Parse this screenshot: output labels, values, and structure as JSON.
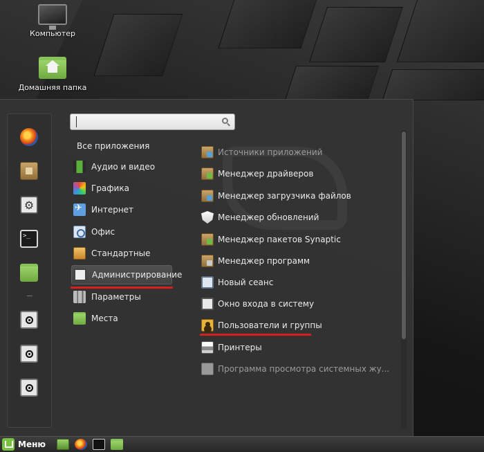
{
  "desktop": {
    "icons": [
      {
        "label": "Компьютер",
        "icon": "computer-icon"
      },
      {
        "label": "Домашняя папка",
        "icon": "home-folder-icon"
      }
    ]
  },
  "menu": {
    "favorites": [
      {
        "icon": "firefox-icon"
      },
      {
        "icon": "package-manager-icon"
      },
      {
        "icon": "system-settings-icon"
      },
      {
        "icon": "terminal-icon"
      },
      {
        "icon": "folder-icon"
      },
      {
        "icon": "lock-screen-icon"
      },
      {
        "icon": "logout-icon"
      },
      {
        "icon": "shutdown-icon"
      }
    ],
    "search": {
      "value": "",
      "placeholder": ""
    },
    "all_apps_label": "Все приложения",
    "categories": [
      {
        "label": "Аудио и видео",
        "icon": "audio-video-icon"
      },
      {
        "label": "Графика",
        "icon": "graphics-icon"
      },
      {
        "label": "Интернет",
        "icon": "internet-icon"
      },
      {
        "label": "Офис",
        "icon": "office-icon"
      },
      {
        "label": "Стандартные",
        "icon": "accessories-icon"
      },
      {
        "label": "Администрирование",
        "icon": "administration-icon",
        "active": true
      },
      {
        "label": "Параметры",
        "icon": "preferences-icon"
      },
      {
        "label": "Места",
        "icon": "places-icon"
      }
    ],
    "apps": [
      {
        "label": "Источники приложений",
        "icon": "software-sources-icon"
      },
      {
        "label": "Менеджер драйверов",
        "icon": "driver-manager-icon"
      },
      {
        "label": "Менеджер загрузчика файлов",
        "icon": "upload-manager-icon"
      },
      {
        "label": "Менеджер обновлений",
        "icon": "update-manager-icon"
      },
      {
        "label": "Менеджер пакетов Synaptic",
        "icon": "synaptic-icon"
      },
      {
        "label": "Менеджер программ",
        "icon": "software-manager-icon"
      },
      {
        "label": "Новый сеанс",
        "icon": "new-session-icon"
      },
      {
        "label": "Окно входа в систему",
        "icon": "login-window-icon"
      },
      {
        "label": "Пользователи и группы",
        "icon": "users-groups-icon"
      },
      {
        "label": "Принтеры",
        "icon": "printers-icon"
      },
      {
        "label": "Программа просмотра системных жу...",
        "icon": "system-log-icon"
      }
    ]
  },
  "panel": {
    "menu_label": "Меню"
  },
  "colors": {
    "highlight_underline": "#d6201f",
    "menu_bg": "#343434",
    "mint_green": "#7ac143"
  }
}
